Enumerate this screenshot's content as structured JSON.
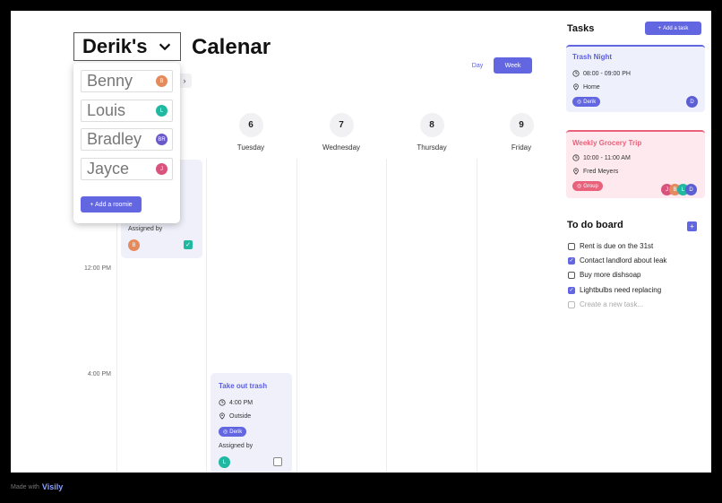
{
  "header": {
    "user_select": "Derik's",
    "title": "Calenar",
    "views": {
      "day": "Day",
      "week": "Week"
    }
  },
  "days": [
    {
      "num": "6",
      "name": "Tuesday"
    },
    {
      "num": "7",
      "name": "Wednesday"
    },
    {
      "num": "8",
      "name": "Thursday"
    },
    {
      "num": "9",
      "name": "Friday"
    }
  ],
  "times": [
    "12:00 PM",
    "4:00 PM"
  ],
  "events": {
    "monday": {
      "assigned_label": "Assigned by",
      "avatar": "B"
    },
    "trash": {
      "title": "Take out trash",
      "time": "4:00 PM",
      "location": "Outside",
      "tag": "Derik",
      "assigned_label": "Assigned by",
      "avatar": "L"
    }
  },
  "dropdown": {
    "users": [
      {
        "name": "Benny",
        "initial": "B"
      },
      {
        "name": "Louis",
        "initial": "L"
      },
      {
        "name": "Bradley",
        "initial": "BR"
      },
      {
        "name": "Jayce",
        "initial": "J"
      }
    ],
    "add_label": "+ Add a roomie"
  },
  "tasks": {
    "title": "Tasks",
    "add_label": "Add a task",
    "cards": [
      {
        "title": "Trash  Night",
        "time": "08:00 - 09:00 PH",
        "location": "Home",
        "tag": "Derik",
        "avatars": [
          "D"
        ]
      },
      {
        "title": "Weekly Grocery Trip",
        "time": "10:00 - 11:00 AM",
        "location": "Fred Meyers",
        "tag": "Group",
        "avatars": [
          "J",
          "B",
          "L",
          "D"
        ]
      }
    ]
  },
  "todo": {
    "title": "To do board",
    "add_symbol": "+",
    "items": [
      {
        "text": "Rent is due on the 31st",
        "done": false
      },
      {
        "text": "Contact landlord about leak",
        "done": true
      },
      {
        "text": "Buy more dishsoap",
        "done": false
      },
      {
        "text": "Lightbulbs need replacing",
        "done": true
      }
    ],
    "placeholder": "Create a new task..."
  },
  "footer": {
    "made_with": "Made with",
    "brand": "Visily"
  },
  "colors": {
    "accent": "#6366e1",
    "pink": "#e8627c",
    "teal": "#20b8a0"
  },
  "icons": [
    "chevron-down-icon",
    "clock-icon",
    "location-pin-icon",
    "user-circle-icon",
    "plus-icon",
    "check-icon",
    "chevron-right-icon"
  ]
}
